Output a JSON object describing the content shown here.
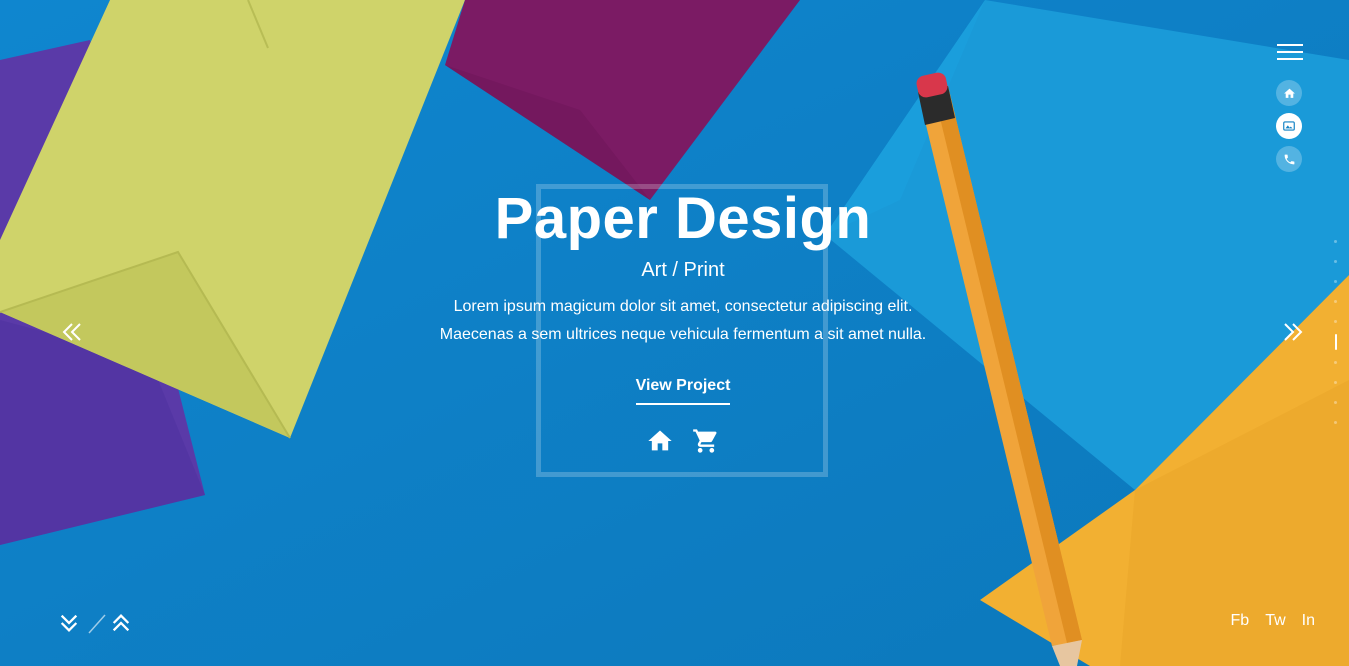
{
  "hero": {
    "title": "Paper Design",
    "subtitle": "Art / Print",
    "description_line1": "Lorem ipsum magicum dolor sit amet, consectetur adipiscing elit.",
    "description_line2": "Maecenas a sem ultrices neque vehicula fermentum a sit amet nulla.",
    "cta_label": "View Project"
  },
  "social": {
    "fb": "Fb",
    "tw": "Tw",
    "in": "In"
  },
  "icons": {
    "menu": "hamburger-menu-icon",
    "nav": [
      "home-icon",
      "gallery-icon",
      "phone-icon"
    ],
    "hero_actions": [
      "home-icon",
      "cart-icon"
    ],
    "prev": "double-chevron-left-icon",
    "next": "double-chevron-right-icon",
    "scroll_down": "double-chevron-down-icon",
    "scroll_up": "double-chevron-up-icon"
  },
  "colors": {
    "background_blue": "#1181c4",
    "accent_white": "#ffffff",
    "purple": "#5a3aa8",
    "lime": "#cfd36a",
    "magenta": "#7b1b64",
    "yellow": "#f2b032"
  }
}
